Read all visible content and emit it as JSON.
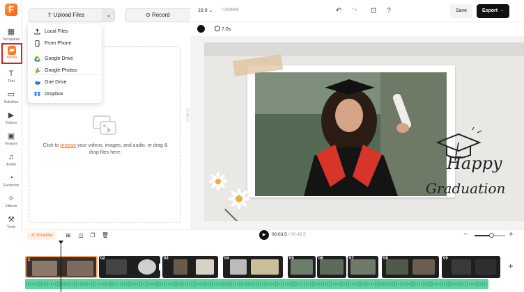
{
  "app": {
    "logo_letter": "F"
  },
  "sidebar": {
    "items": [
      {
        "label": "Templates",
        "icon": "template-icon",
        "active": false
      },
      {
        "label": "Media",
        "icon": "media-folder-icon",
        "active": true
      },
      {
        "label": "Text",
        "icon": "text-icon",
        "active": false
      },
      {
        "label": "Subtitles",
        "icon": "subtitles-icon",
        "active": false
      },
      {
        "label": "Videos",
        "icon": "video-icon",
        "active": false
      },
      {
        "label": "Images",
        "icon": "image-icon",
        "active": false
      },
      {
        "label": "Audio",
        "icon": "audio-icon",
        "active": false
      },
      {
        "label": "Elements",
        "icon": "elements-icon",
        "active": false
      },
      {
        "label": "Effects",
        "icon": "effects-icon",
        "active": false
      },
      {
        "label": "Tools",
        "icon": "tools-icon",
        "active": false
      }
    ]
  },
  "panel": {
    "upload_label": "Upload Files",
    "record_label": "Record",
    "drop_text_before": "Click to ",
    "drop_link": "browse",
    "drop_text_after": " your videos, images, and audio, or drag & drop files here."
  },
  "upload_menu": {
    "items": [
      {
        "label": "Local Files",
        "icon": "upload-icon"
      },
      {
        "label": "From Phone",
        "icon": "phone-icon"
      },
      {
        "label": "Google Drive",
        "icon": "google-drive-icon"
      },
      {
        "label": "Google Photos",
        "icon": "google-photos-icon"
      },
      {
        "label": "One Drive",
        "icon": "onedrive-icon"
      },
      {
        "label": "Dropbox",
        "icon": "dropbox-icon"
      }
    ]
  },
  "topbar": {
    "aspect_ratio": "16:9",
    "project_title": "Untitled",
    "save_label": "Save",
    "export_label": "Export"
  },
  "canvas_toolbar": {
    "duration": "7.0s"
  },
  "canvas": {
    "line1": "Happy",
    "line2": "Graduation"
  },
  "timeline": {
    "label": "Timeline",
    "current_time": "00:03.5",
    "total_time": "/ 00:45.5",
    "zoom_level": 0.55,
    "clips": [
      "1",
      "02",
      "03",
      "04",
      "05",
      "06",
      "07",
      "08",
      "09"
    ]
  },
  "colors": {
    "accent": "#ff6a1a",
    "export_bg": "#111111",
    "audio": "#62d3a3"
  }
}
